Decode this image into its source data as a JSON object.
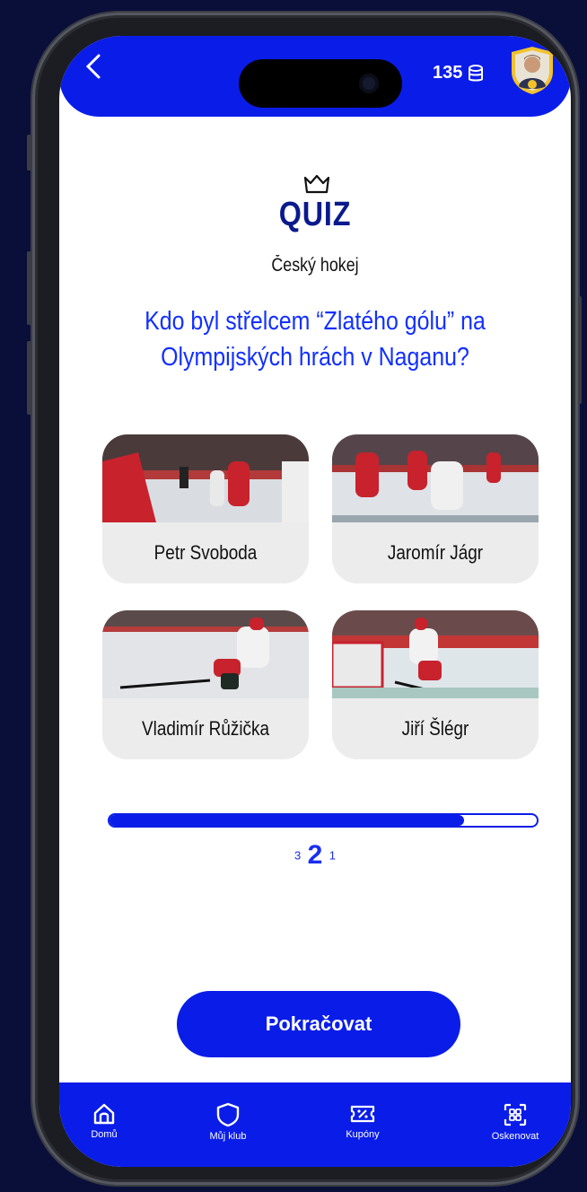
{
  "header": {
    "coins": "135",
    "coin_icon": "coins-stack-icon",
    "avatar_icon": "user-avatar-badge"
  },
  "quiz": {
    "title": "QUIZ",
    "category": "Český hokej",
    "question": "Kdo byl střelcem “Zlatého gólu” na Olympijských hrách v Naganu?",
    "answers": [
      {
        "label": "Petr Svoboda"
      },
      {
        "label": "Jaromír Jágr"
      },
      {
        "label": "Vladimír Růžička"
      },
      {
        "label": "Jiří Šlégr"
      }
    ],
    "progress": 0.83,
    "countdown": {
      "prev": "3",
      "current": "2",
      "next": "1"
    },
    "continue_label": "Pokračovat"
  },
  "nav": {
    "items": [
      {
        "label": "Domů",
        "icon": "home-icon"
      },
      {
        "label": "Můj klub",
        "icon": "shield-icon"
      },
      {
        "label": "Kupóny",
        "icon": "coupon-icon"
      },
      {
        "label": "Oskenovat",
        "icon": "scan-icon"
      }
    ]
  },
  "colors": {
    "accent": "#0a1de8",
    "question": "#1230ff",
    "title": "#0a1a8c",
    "background": "#0a0f3a"
  }
}
